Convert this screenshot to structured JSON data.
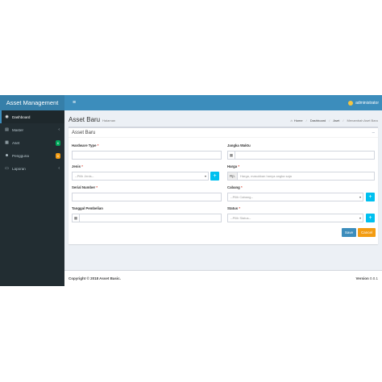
{
  "brand": "Asset Management",
  "user": "administrator",
  "sidebar": {
    "items": [
      {
        "icon": "dashboard-icon",
        "label": "Dashboard"
      },
      {
        "icon": "list-icon",
        "label": "Master"
      },
      {
        "icon": "database-icon",
        "label": "Aset",
        "badge": "6"
      },
      {
        "icon": "users-icon",
        "label": "Pengguna",
        "badge": "0"
      },
      {
        "icon": "book-icon",
        "label": "Laporan"
      }
    ]
  },
  "header": {
    "title": "Asset Baru",
    "subtitle": "Halaman",
    "breadcrumb": [
      "Home",
      "Dashboard",
      "Aset",
      "Menambah Aset Baru"
    ]
  },
  "form": {
    "box_title": "Asset Baru",
    "hardware_type": {
      "label": "Hardware Type",
      "required": "*"
    },
    "jangka_waktu": {
      "label": "Jangka Waktu"
    },
    "jenis": {
      "label": "Jenis",
      "required": "*",
      "placeholder": "--Pilih Jenis--"
    },
    "harga": {
      "label": "Harga",
      "required": "*",
      "prefix": "Rp.",
      "placeholder": "Harga, masukkan hanya angka saja"
    },
    "serial_number": {
      "label": "Serial Number",
      "required": "*"
    },
    "cabang": {
      "label": "Cabang",
      "required": "*",
      "placeholder": "--Pilih Cabang--"
    },
    "tanggal_pembelian": {
      "label": "Tanggal Pembelian"
    },
    "status": {
      "label": "Status",
      "required": "*",
      "placeholder": "--Pilih Status--"
    },
    "save_label": "Save",
    "cancel_label": "Cancel"
  },
  "footer": {
    "copyright": "Copyright © 2018 Asset Basic.",
    "version_label": "Version",
    "version": "0.0.1"
  },
  "colors": {
    "primary": "#3c8dbc",
    "sidebar": "#222d32",
    "info": "#00c0ef",
    "warning": "#f39c12",
    "success": "#00a65a"
  }
}
